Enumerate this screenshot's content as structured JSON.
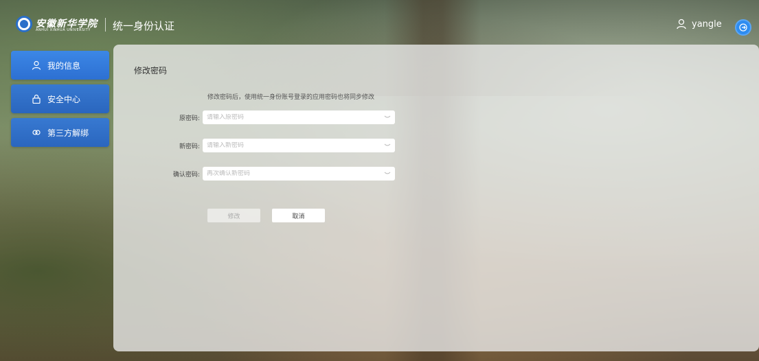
{
  "header": {
    "logo_text": "安徽新华学院",
    "logo_sub": "ANHUI XINHUA UNIVERSITY",
    "system_title": "统一身份认证",
    "username": "yangle"
  },
  "sidebar": {
    "items": [
      {
        "label": "我的信息",
        "icon": "user-icon"
      },
      {
        "label": "安全中心",
        "icon": "lock-icon"
      },
      {
        "label": "第三方解绑",
        "icon": "link-icon"
      }
    ]
  },
  "main": {
    "title": "修改密码",
    "notice": "修改密码后，使用统一身份账号登录的应用密码也将同步修改",
    "fields": [
      {
        "label": "原密码:",
        "placeholder": "请输入原密码"
      },
      {
        "label": "新密码:",
        "placeholder": "请输入新密码"
      },
      {
        "label": "确认密码:",
        "placeholder": "再次确认新密码"
      }
    ],
    "submit_label": "修改",
    "cancel_label": "取消"
  },
  "colors": {
    "accent": "#2d8cf0",
    "sidebar_bg": "#3478d7"
  }
}
